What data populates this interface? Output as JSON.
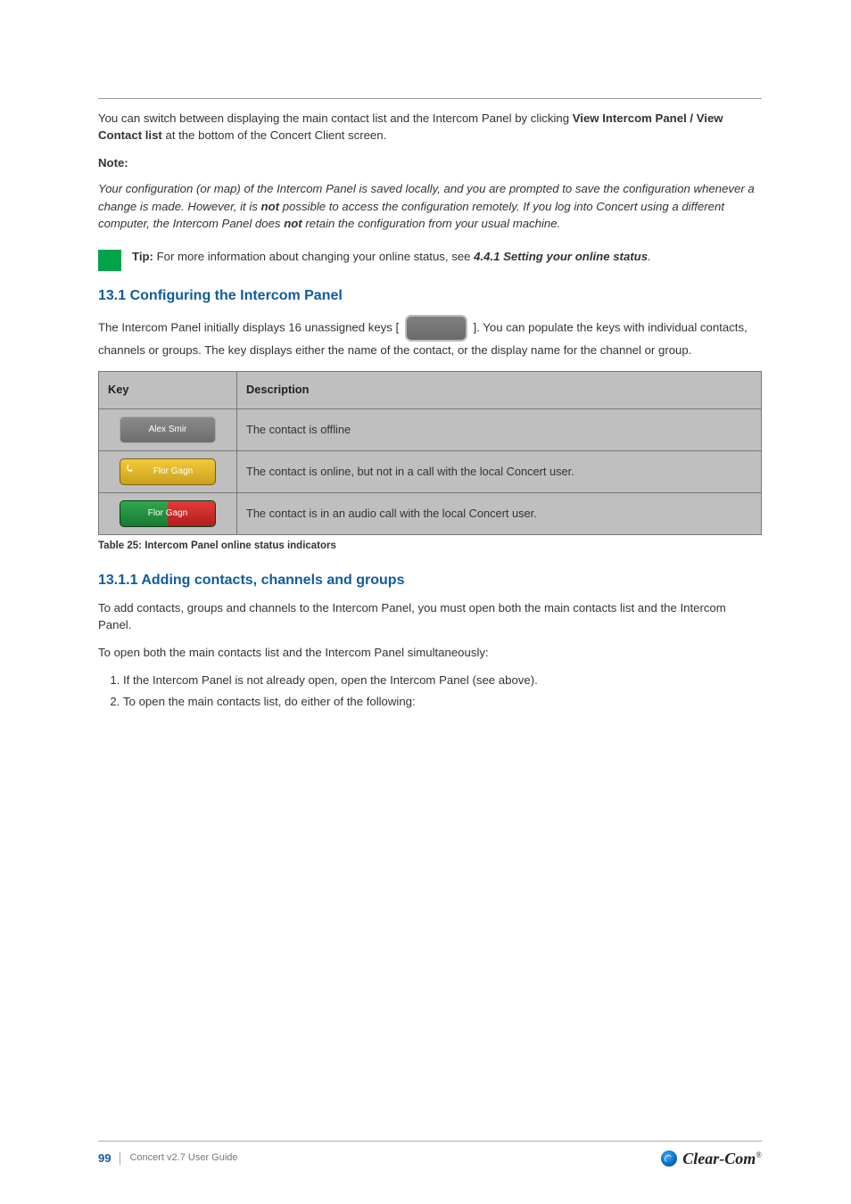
{
  "intro": {
    "p1_a": "You can switch between displaying the main contact list and the Intercom Panel by clicking ",
    "p1_b": " at the bottom of the Concert Client screen.",
    "view_btn": "View Intercom Panel / View Contact list",
    "note_label": "Note:",
    "note_body_a": "Your configuration (or map) of the Intercom Panel is saved locally, and you are prompted to save the configuration whenever a change is made. However, it is ",
    "note_body_b": " possible to access the configuration remotely. If you log into Concert using a different computer, the Intercom Panel does ",
    "note_body_c": " retain the configuration from your usual machine.",
    "not_word": "not"
  },
  "tip": {
    "label": "Tip:",
    "body_a": " For more information about changing your online status, see ",
    "xref": "4.4.1 Setting your online status",
    "body_b": "."
  },
  "section_configuring": {
    "heading": "13.1 Configuring the Intercom Panel",
    "p_a": "The Intercom Panel initially displays 16 unassigned keys [ ",
    "p_b": " ]. You can populate the keys with individual contacts, channels or groups. The key displays either the name of the contact, or the display name for the channel or group."
  },
  "table": {
    "th_key": "Key",
    "th_desc": "Description",
    "rows": [
      {
        "label": "Alex Smir",
        "desc": "The contact is offline"
      },
      {
        "label": "Flor Gagn",
        "desc": "The contact is online, but not in a call with the local Concert user."
      },
      {
        "label": "Flor Gagn",
        "desc": "The contact is in an audio call with the local Concert user."
      }
    ],
    "caption": "Table 25: Intercom Panel online status indicators"
  },
  "contacts": {
    "heading": "13.1.1 Adding contacts, channels and groups",
    "p1": "To add contacts, groups and channels to the Intercom Panel, you must open both the main contacts list and the Intercom Panel.",
    "p2": "To open both the main contacts list and the Intercom Panel simultaneously:",
    "steps": [
      "If the Intercom Panel is not already open, open the Intercom Panel (see above).",
      "To open the main contacts list, do either of the following:"
    ]
  },
  "footer": {
    "page": "99",
    "title": "Concert v2.7 User Guide",
    "brand": "Clear-Com"
  }
}
